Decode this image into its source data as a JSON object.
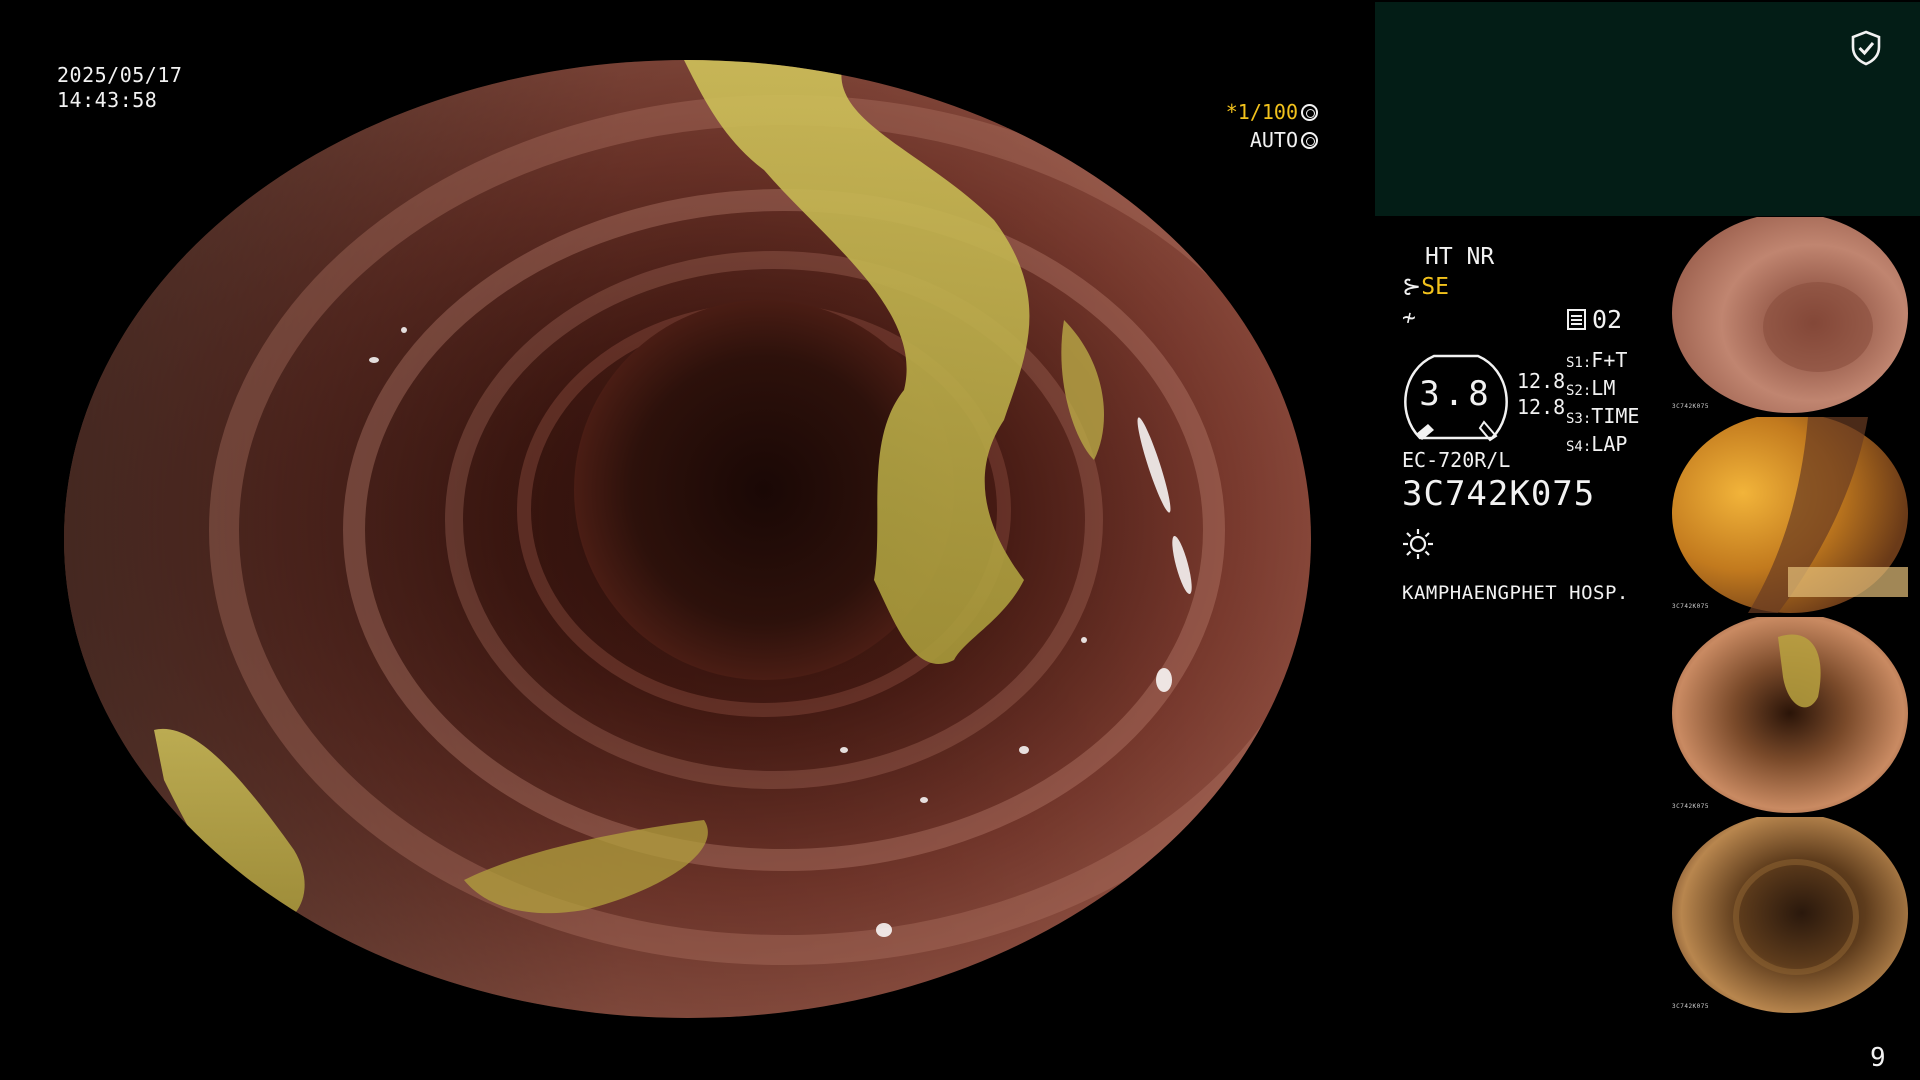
{
  "overlay": {
    "date": "2025/05/17",
    "time": "14:43:58",
    "shutter_prefix": "*",
    "shutter": "1/100",
    "exposure_mode": "AUTO"
  },
  "settings": {
    "structure_enhancement": "HT NR",
    "color_enhancement": "SE",
    "memo_count": "02",
    "gauge_value": "3.8",
    "gauge_side": [
      "12.8",
      "12.8"
    ],
    "switches": [
      {
        "key": "S1:",
        "value": "F+T"
      },
      {
        "key": "S2:",
        "value": "LM"
      },
      {
        "key": "S3:",
        "value": "TIME"
      },
      {
        "key": "S4:",
        "value": "LAP"
      }
    ],
    "scope_model": "EC-720R/L",
    "scope_serial": "3C742K075",
    "hospital": "KAMPHAENGPHET HOSP."
  },
  "thumbnails": {
    "captions": [
      "3C742K075",
      "3C742K075",
      "3C742K075",
      "3C742K075"
    ]
  },
  "page_number": "9",
  "colors": {
    "accent_yellow": "#f2c21c",
    "panel_green": "#031d16",
    "text": "#f2f2f2"
  },
  "icons": [
    "shield-check-icon",
    "shutter-icon",
    "aperture-icon",
    "se-icon",
    "iris-icon",
    "memo-icon",
    "light-source-icon"
  ]
}
